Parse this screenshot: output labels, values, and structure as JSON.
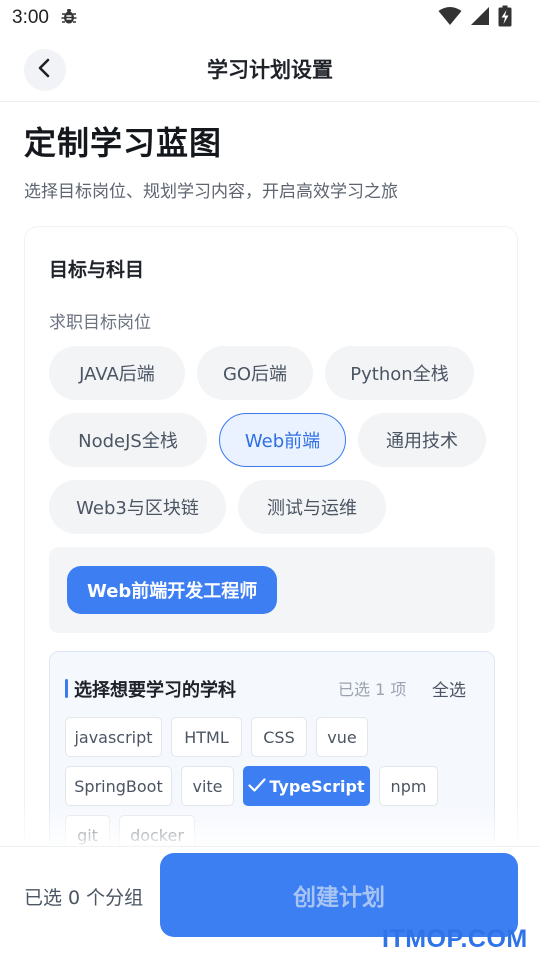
{
  "status_bar": {
    "time": "3:00",
    "icons": [
      "bug-icon",
      "wifi-icon",
      "signal-icon",
      "battery-charging-icon"
    ]
  },
  "header": {
    "title": "学习计划设置",
    "back_icon": "back-icon"
  },
  "hero": {
    "title": "定制学习蓝图",
    "subtitle": "选择目标岗位、规划学习内容，开启高效学习之旅"
  },
  "target": {
    "section_title": "目标与科目",
    "field_label": "求职目标岗位",
    "positions": [
      {
        "label": "JAVA后端",
        "selected": false
      },
      {
        "label": "GO后端",
        "selected": false
      },
      {
        "label": "Python全栈",
        "selected": false
      },
      {
        "label": "NodeJS全栈",
        "selected": false
      },
      {
        "label": "Web前端",
        "selected": true
      },
      {
        "label": "通用技术",
        "selected": false
      },
      {
        "label": "Web3与区块链",
        "selected": false
      },
      {
        "label": "测试与运维",
        "selected": false
      }
    ],
    "selected_position": "Web前端开发工程师"
  },
  "subjects": {
    "title": "选择想要学习的学科",
    "count_text": "已选 1 项",
    "select_all": "全选",
    "tags": [
      {
        "label": "javascript",
        "selected": false
      },
      {
        "label": "HTML",
        "selected": false
      },
      {
        "label": "CSS",
        "selected": false
      },
      {
        "label": "vue",
        "selected": false
      },
      {
        "label": "SpringBoot",
        "selected": false
      },
      {
        "label": "vite",
        "selected": false
      },
      {
        "label": "TypeScript",
        "selected": true
      },
      {
        "label": "npm",
        "selected": false
      },
      {
        "label": "git",
        "selected": false
      },
      {
        "label": "docker",
        "selected": false
      }
    ]
  },
  "bottom": {
    "group_count": "已选 0 个分组",
    "create_button": "创建计划"
  },
  "watermark": "ITMOP.COM",
  "colors": {
    "accent": "#3b7ff2",
    "chip_bg": "#f3f4f6",
    "active_chip_bg": "#eaf2ff"
  }
}
